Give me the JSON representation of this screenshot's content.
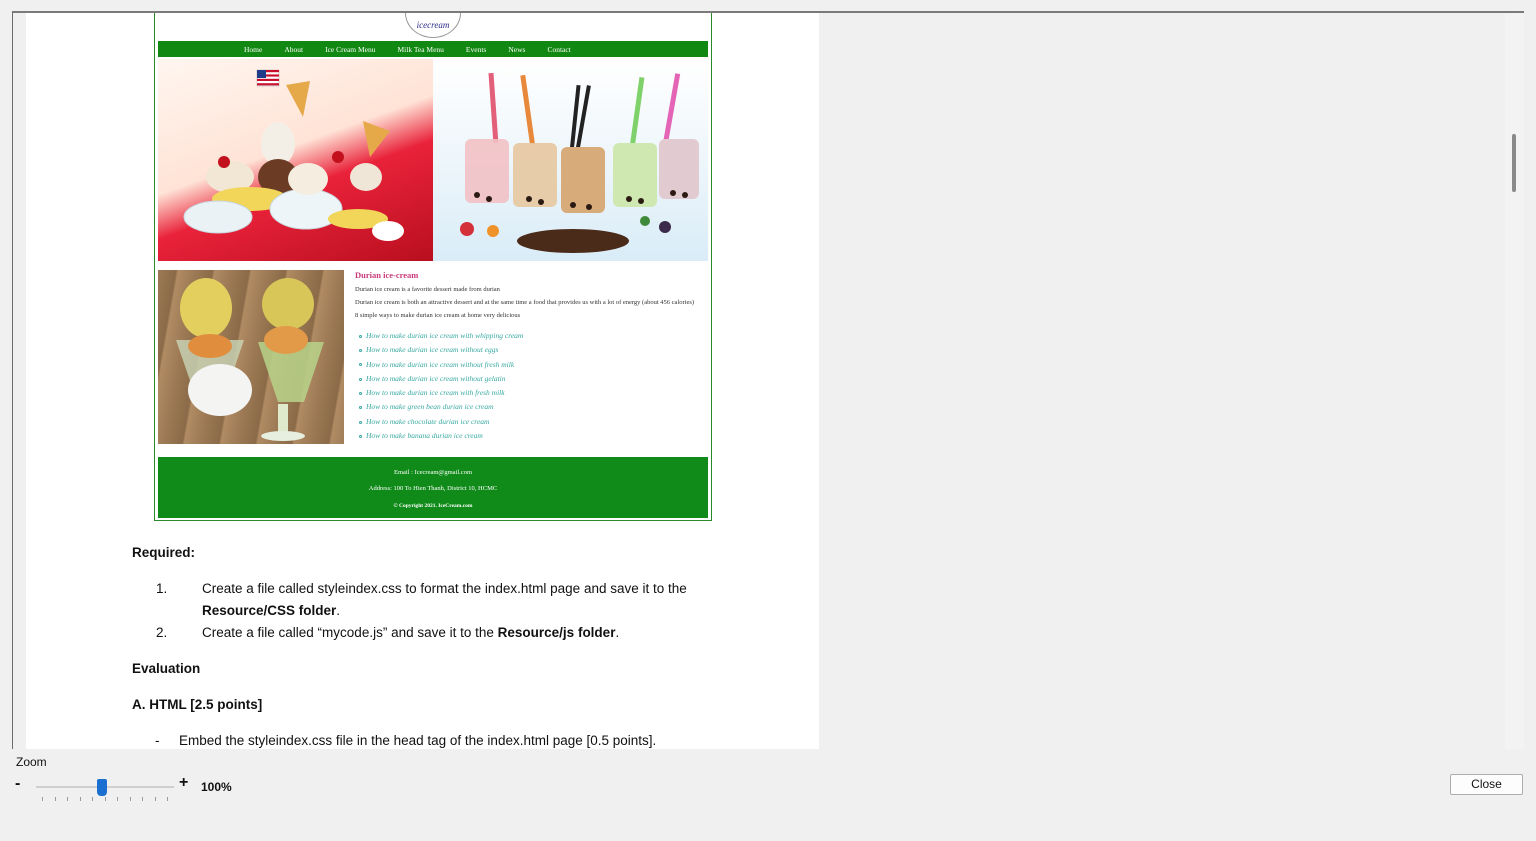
{
  "document": {
    "website": {
      "logo_text": "icecream",
      "nav": [
        "Home",
        "About",
        "Ice Cream Menu",
        "Milk Tea Menu",
        "Events",
        "News",
        "Contact"
      ],
      "flag_icon": "us-flag-icon",
      "content": {
        "title": "Durian ice-cream",
        "p1": "Durian ice cream is a favorite dessert made from durian",
        "p2": "Durian ice cream is both an attractive dessert and at the same time a food that provides us with a lot of energy (about 456 calories)",
        "p3": "8 simple ways to make durian ice cream at home very delicious",
        "links": [
          "How to make durian ice cream with whipping cream",
          "How to make durian ice cream without eggs",
          "How to make durian ice cream without fresh milk",
          "How to make durian ice cream without gelatin",
          "How to make durian ice cream with fresh milk",
          "How to make green bean durian ice cream",
          "How to make chocolate durian ice cream",
          "How to make banana durian ice cream"
        ]
      },
      "footer": {
        "email": "Email : Icecream@gmail.com",
        "address": "Address: 100 To Hien Thanh, District 10, HCMC",
        "copyright": "© Copyright 2021. IceCream.com"
      }
    },
    "required_heading": "Required:",
    "req1_num": "1.",
    "req1_text": "Create a file called styleindex.css to format the index.html page and save it to the",
    "req1_bold": "Resource/CSS  folder",
    "req1_end": ".",
    "req2_num": "2.",
    "req2_text": "Create a file called “mycode.js” and save it to the ",
    "req2_bold": "Resource/js folder",
    "req2_end": ".",
    "evaluation_heading": "Evaluation",
    "section_a_heading": "A. HTML  [2.5  points]",
    "bullet1_dash": "-",
    "bullet1_text": "Embed the styleindex.css file in the head tag of the index.html page [0.5 points]."
  },
  "zoom": {
    "label": "Zoom",
    "minus": "-",
    "plus": "+",
    "value": "100%",
    "level_percent": 100,
    "slider_fraction": 0.48
  },
  "close_label": "Close"
}
